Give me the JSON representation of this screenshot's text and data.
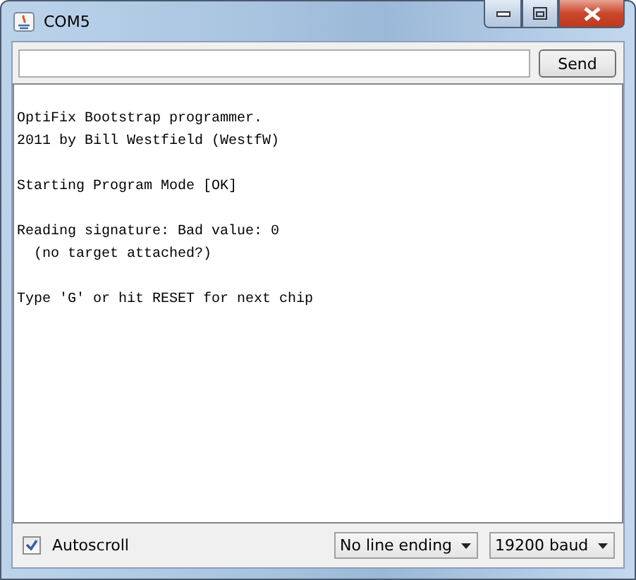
{
  "window": {
    "title": "COM5"
  },
  "send_button": {
    "label": "Send"
  },
  "output": [
    [
      "OptiFix Bootstrap programmer.",
      "2011 by Bill Westfield (WestfW)"
    ],
    [
      "Starting Program Mode [OK]"
    ],
    [
      "Reading signature: Bad value: 0",
      "  (no target attached?)"
    ],
    [
      "Type 'G' or hit RESET for next chip"
    ]
  ],
  "autoscroll": {
    "label": "Autoscroll",
    "checked": true
  },
  "line_ending": {
    "value": "No line ending"
  },
  "baud": {
    "value": "19200 baud"
  }
}
